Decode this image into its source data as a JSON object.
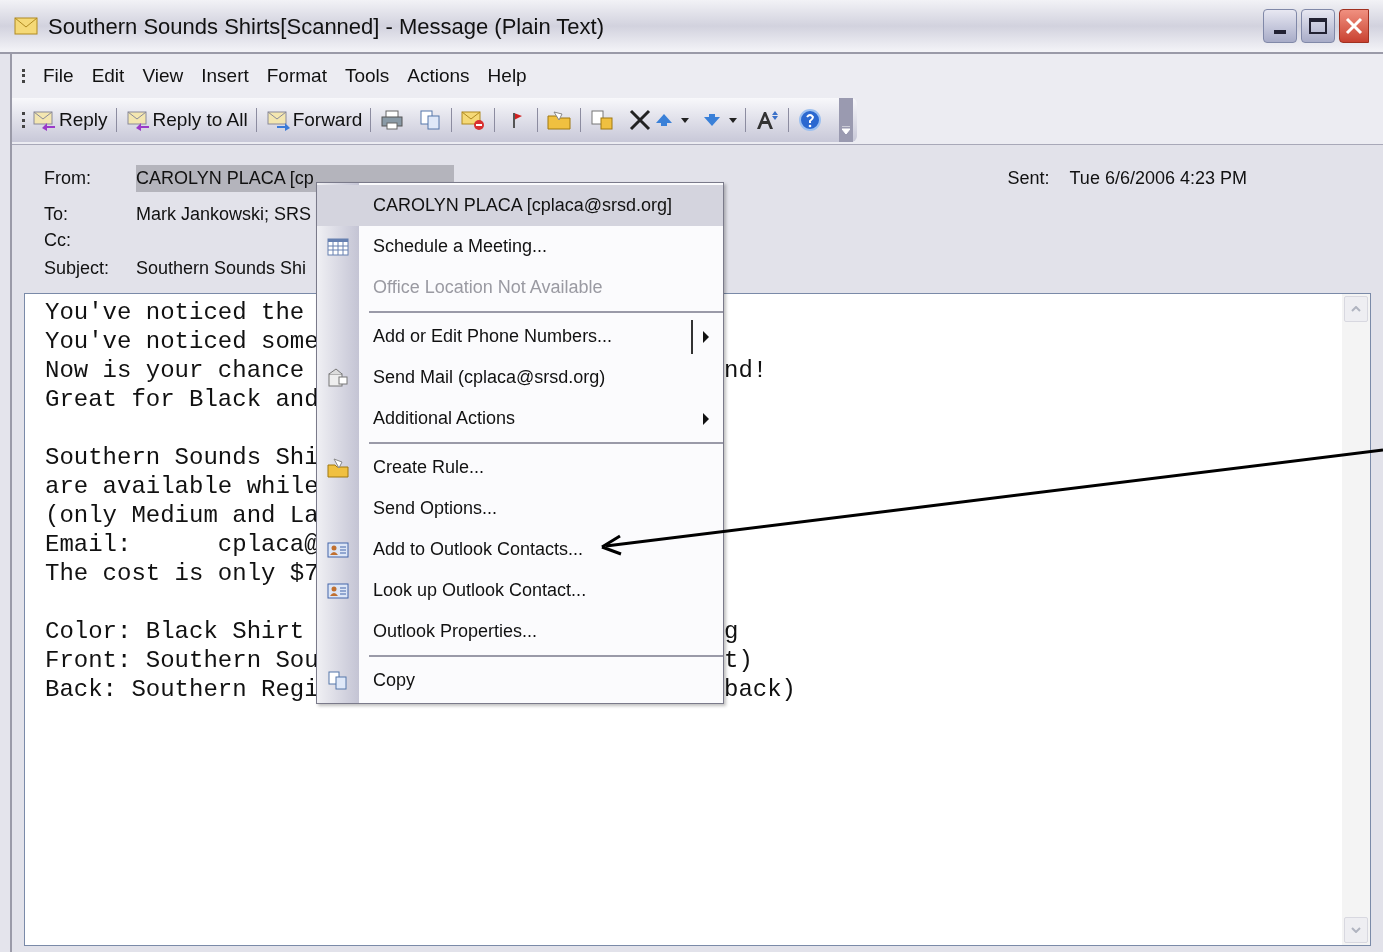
{
  "window": {
    "title": "Southern Sounds Shirts[Scanned] - Message (Plain Text)"
  },
  "menu_bar": [
    "File",
    "Edit",
    "View",
    "Insert",
    "Format",
    "Tools",
    "Actions",
    "Help"
  ],
  "toolbar": [
    {
      "kind": "reply",
      "label": "Reply"
    },
    {
      "kind": "reply_all",
      "label": "Reply to All"
    },
    {
      "kind": "forward",
      "label": "Forward"
    },
    {
      "kind": "print"
    },
    {
      "kind": "copy"
    },
    {
      "kind": "envelope"
    },
    {
      "kind": "flag"
    },
    {
      "kind": "folder"
    },
    {
      "kind": "move"
    },
    {
      "kind": "delete"
    },
    {
      "kind": "up"
    },
    {
      "kind": "down"
    },
    {
      "kind": "font"
    },
    {
      "kind": "help"
    }
  ],
  "header": {
    "from_label": "From:",
    "from": "CAROLYN PLACA [cp",
    "from_selected": true,
    "to_label": "To:",
    "to": "Mark Jankowski; SRS",
    "cc_label": "Cc:",
    "subject_label": "Subject:",
    "subject": "Southern Sounds Shi",
    "sent_label": "Sent:",
    "sent": "Tue 6/6/2006 4:23 PM"
  },
  "body_lines": [
    {
      "kind": "text",
      "left": "You've noticed the"
    },
    {
      "kind": "text",
      "left": "You've noticed some"
    },
    {
      "kind": "text",
      "left": "Now is your chance",
      "right": "nd!"
    },
    {
      "kind": "text",
      "left": "Great for Black and"
    },
    {
      "kind": "blank"
    },
    {
      "kind": "text",
      "left": "Southern Sounds Shi"
    },
    {
      "kind": "text",
      "left": "are available while"
    },
    {
      "kind": "text",
      "left": "(only Medium and La"
    },
    {
      "kind": "text",
      "left": "Email:      cplaca@"
    },
    {
      "kind": "text",
      "left": "The cost is only $7"
    },
    {
      "kind": "blank"
    },
    {
      "kind": "text",
      "left": "Color: Black Shirt",
      "right": "g"
    },
    {
      "kind": "text",
      "left": "Front: Southern Sou",
      "right": "t)"
    },
    {
      "kind": "text",
      "left": "Back: Southern Regi",
      "right": "back)"
    }
  ],
  "context_menu": [
    {
      "label": "CAROLYN PLACA [cplaca@srsd.org]",
      "selected": true,
      "disabled": false
    },
    {
      "label": "Schedule a Meeting...",
      "kind": "calendar",
      "selected": false,
      "disabled": false
    },
    {
      "label": "Office Location Not Available",
      "selected": false,
      "disabled": true
    },
    {
      "label": "Add or Edit Phone Numbers...",
      "submenu": true,
      "split": true,
      "separator_before": true,
      "selected": false,
      "disabled": false
    },
    {
      "label": "Send Mail (cplaca@srsd.org)",
      "kind": "mail",
      "selected": false,
      "disabled": false
    },
    {
      "label": "Additional Actions",
      "submenu": true,
      "selected": false,
      "disabled": false
    },
    {
      "label": "Create Rule...",
      "kind": "folder",
      "separator_before": true,
      "selected": false,
      "disabled": false
    },
    {
      "label": "Send Options...",
      "selected": false,
      "disabled": false
    },
    {
      "label": "Add to Outlook Contacts...",
      "kind": "contact",
      "selected": false,
      "disabled": false
    },
    {
      "label": "Look up Outlook Contact...",
      "kind": "contact",
      "selected": false,
      "disabled": false
    },
    {
      "label": "Outlook Properties...",
      "selected": false,
      "disabled": false
    },
    {
      "label": "Copy",
      "kind": "copy",
      "separator_before": true,
      "selected": false,
      "disabled": false
    }
  ]
}
